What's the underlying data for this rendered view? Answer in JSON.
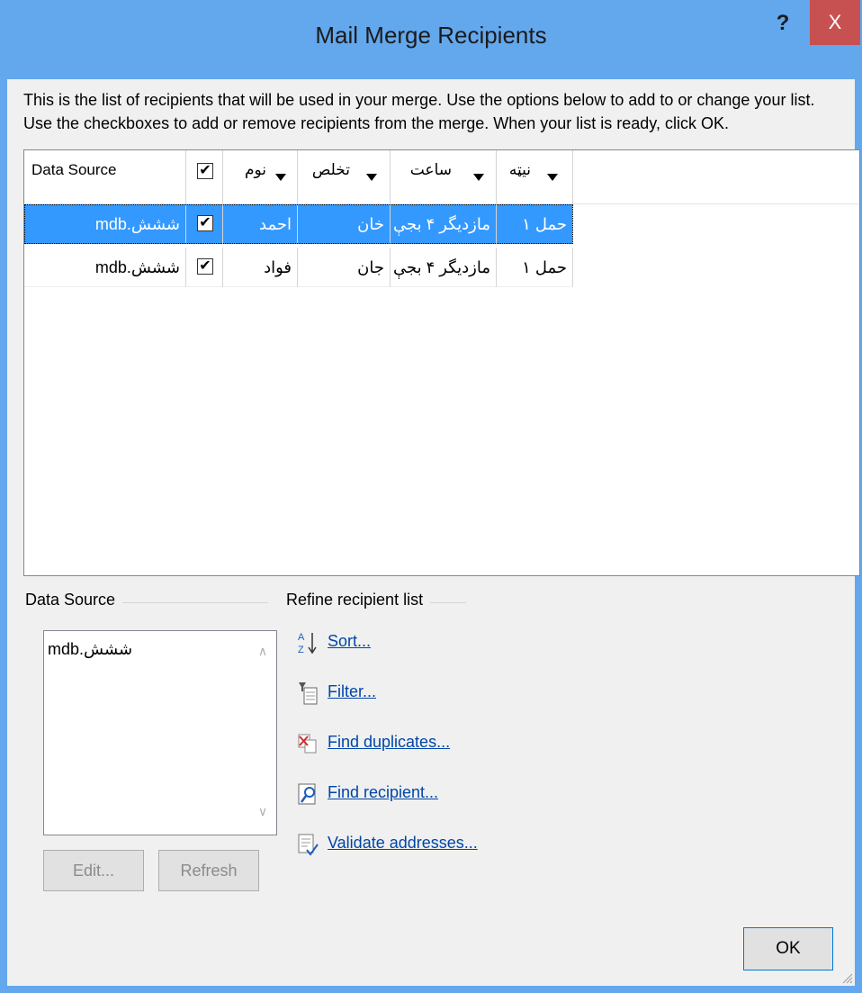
{
  "window": {
    "title": "Mail Merge Recipients",
    "help_label": "?",
    "close_label": "X"
  },
  "intro": {
    "line1": "This is the list of recipients that will be used in your merge.  Use the options below to add to or change your list.",
    "line2": "Use the checkboxes to add or remove recipients from the merge.  When your list is ready, click OK."
  },
  "grid": {
    "columns": [
      "Data Source",
      "",
      "نوم",
      "تخلص",
      "ساعت",
      "نیټه"
    ],
    "header_checkbox": "✔",
    "rows": [
      {
        "source": "ششش.mdb",
        "checked": "✔",
        "name": "احمد",
        "lastname": "خان",
        "time": "مازدیگر ۴ بجې",
        "date": "حمل ۱",
        "selected": true
      },
      {
        "source": "ششش.mdb",
        "checked": "✔",
        "name": "فواد",
        "lastname": "جان",
        "time": "مازدیگر ۴ بجې",
        "date": "حمل ۱",
        "selected": false
      }
    ]
  },
  "data_source": {
    "group_label": "Data Source",
    "items": [
      "ششش.mdb"
    ],
    "edit_label": "Edit...",
    "refresh_label": "Refresh"
  },
  "refine": {
    "group_label": "Refine recipient list",
    "links": [
      {
        "label": "Sort...",
        "icon": "sort-icon"
      },
      {
        "label": "Filter...",
        "icon": "filter-icon"
      },
      {
        "label": "Find duplicates...",
        "icon": "find-duplicates-icon"
      },
      {
        "label": "Find recipient...",
        "icon": "find-recipient-icon"
      },
      {
        "label": "Validate addresses...",
        "icon": "validate-icon"
      }
    ]
  },
  "ok_label": "OK",
  "colors": {
    "titlebar": "#63a7ed",
    "close": "#c75050",
    "selection": "#3399ff",
    "link": "#0046a8"
  }
}
